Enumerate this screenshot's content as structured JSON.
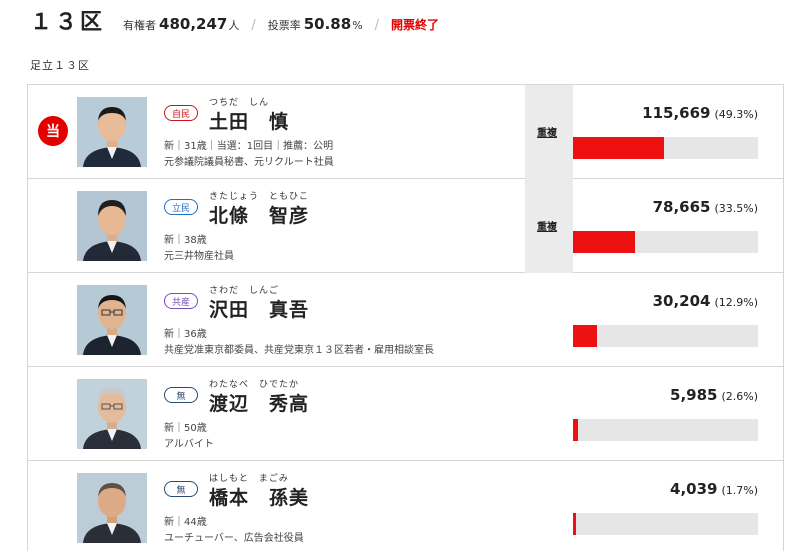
{
  "header": {
    "district": "１３区",
    "voters_label": "有権者",
    "voters_value": "480,247",
    "voters_unit": "人",
    "turnout_label": "投票率",
    "turnout_value": "50.88",
    "turnout_unit": "%",
    "status": "開票終了"
  },
  "region_label": "足立１３区",
  "elected_mark": "当",
  "candidates": [
    {
      "elected": true,
      "party": "自民",
      "party_color": "#c8161d",
      "furigana": "つちだ　しん",
      "name": "土田　慎",
      "meta": "新｜31歳｜当選：1回目｜推薦：公明",
      "career": "元参議院議員秘書、元リクルート社員",
      "duplicate": "重複",
      "votes": "115,669",
      "pct_text": "(49.3%)",
      "share": 49.3
    },
    {
      "elected": false,
      "party": "立民",
      "party_color": "#1e6fc5",
      "furigana": "きたじょう　ともひこ",
      "name": "北條　智彦",
      "meta": "新｜38歳",
      "career": "元三井物産社員",
      "duplicate": "重複",
      "votes": "78,665",
      "pct_text": "(33.5%)",
      "share": 33.5
    },
    {
      "elected": false,
      "party": "共産",
      "party_color": "#7a4db3",
      "furigana": "さわだ　しんご",
      "name": "沢田　真吾",
      "meta": "新｜36歳",
      "career": "共産党准東京都委員、共産党東京１３区若者・雇用相談室長",
      "duplicate": "",
      "votes": "30,204",
      "pct_text": "(12.9%)",
      "share": 12.9
    },
    {
      "elected": false,
      "party": "無",
      "party_color": "#2b4a6f",
      "furigana": "わたなべ　ひでたか",
      "name": "渡辺　秀高",
      "meta": "新｜50歳",
      "career": "アルバイト",
      "duplicate": "",
      "votes": "5,985",
      "pct_text": "(2.6%)",
      "share": 2.6
    },
    {
      "elected": false,
      "party": "無",
      "party_color": "#2b4a6f",
      "furigana": "はしもと　まごみ",
      "name": "橋本　孫美",
      "meta": "新｜44歳",
      "career": "ユーチューバー、広告会社役員",
      "duplicate": "",
      "votes": "4,039",
      "pct_text": "(1.7%)",
      "share": 1.7
    }
  ],
  "bar_color": "#ee1111"
}
